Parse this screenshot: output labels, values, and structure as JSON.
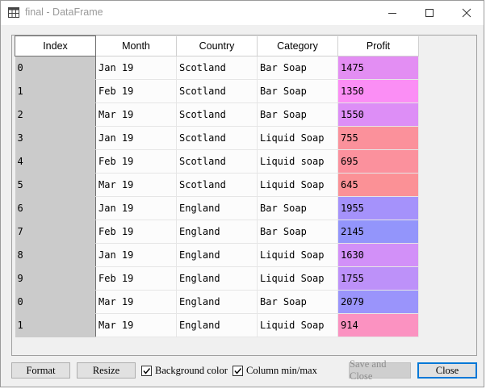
{
  "window": {
    "title": "final - DataFrame",
    "icon": "grid-table-icon",
    "controls": [
      "minimize-icon",
      "maximize-icon",
      "close-icon"
    ]
  },
  "table": {
    "columns": [
      "Index",
      "Month",
      "Country",
      "Category",
      "Profit"
    ],
    "rows": [
      {
        "index": "0",
        "month": "Jan 19",
        "country": "Scotland",
        "category": "Bar Soap",
        "profit": "1475",
        "color": "#e38ef3"
      },
      {
        "index": "1",
        "month": "Feb 19",
        "country": "Scotland",
        "category": "Bar Soap",
        "profit": "1350",
        "color": "#fb8ef5"
      },
      {
        "index": "2",
        "month": "Mar 19",
        "country": "Scotland",
        "category": "Bar Soap",
        "profit": "1550",
        "color": "#dd8ef6"
      },
      {
        "index": "3",
        "month": "Jan 19",
        "country": "Scotland",
        "category": "Liquid Soap",
        "profit": "755",
        "color": "#fb919b"
      },
      {
        "index": "4",
        "month": "Feb 19",
        "country": "Scotland",
        "category": "Liquid soap",
        "profit": "695",
        "color": "#fb919d"
      },
      {
        "index": "5",
        "month": "Mar 19",
        "country": "Scotland",
        "category": "Liquid Soap",
        "profit": "645",
        "color": "#fb9196"
      },
      {
        "index": "6",
        "month": "Jan 19",
        "country": "England",
        "category": "Bar Soap",
        "profit": "1955",
        "color": "#a592fb"
      },
      {
        "index": "7",
        "month": "Feb 19",
        "country": "England",
        "category": "Bar Soap",
        "profit": "2145",
        "color": "#9395fb"
      },
      {
        "index": "8",
        "month": "Jan 19",
        "country": "England",
        "category": "Liquid Soap",
        "profit": "1630",
        "color": "#d290f8"
      },
      {
        "index": "9",
        "month": "Feb 19",
        "country": "England",
        "category": "Liquid Soap",
        "profit": "1755",
        "color": "#bd91f9"
      },
      {
        "index": "0",
        "month": "Mar 19",
        "country": "England",
        "category": "Bar Soap",
        "profit": "2079",
        "color": "#9a94fb"
      },
      {
        "index": "1",
        "month": "Mar 19",
        "country": "England",
        "category": "Liquid Soap",
        "profit": "914",
        "color": "#fb92c1"
      }
    ]
  },
  "footer": {
    "format_label": "Format",
    "resize_label": "Resize",
    "background_color_label": "Background color",
    "background_color_checked": true,
    "column_minmax_label": "Column min/max",
    "column_minmax_checked": true,
    "save_close_label": "Save and Close",
    "close_label": "Close"
  }
}
